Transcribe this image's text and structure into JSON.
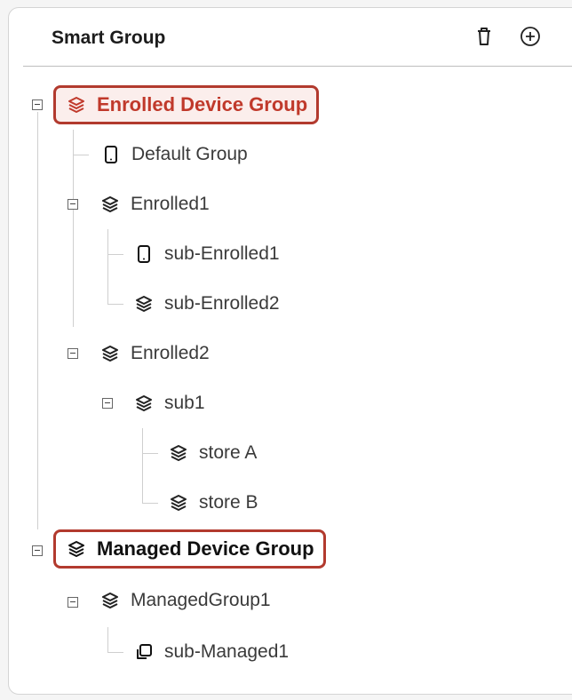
{
  "header": {
    "title": "Smart Group",
    "delete_icon": "trash-icon",
    "add_icon": "plus-circle-icon"
  },
  "tree": {
    "enrolled": {
      "label": "Enrolled Device Group",
      "children": {
        "default_group": "Default Group",
        "enrolled1": {
          "label": "Enrolled1",
          "sub1": "sub-Enrolled1",
          "sub2": "sub-Enrolled2"
        },
        "enrolled2": {
          "label": "Enrolled2",
          "sub1": {
            "label": "sub1",
            "store_a": "store A",
            "store_b": "store B"
          }
        }
      }
    },
    "managed": {
      "label": "Managed Device Group",
      "children": {
        "managedgroup1": {
          "label": "ManagedGroup1",
          "sub": "sub-Managed1"
        }
      }
    }
  },
  "colors": {
    "highlight_border": "#b23a2e",
    "enrolled_text": "#c0392b"
  }
}
